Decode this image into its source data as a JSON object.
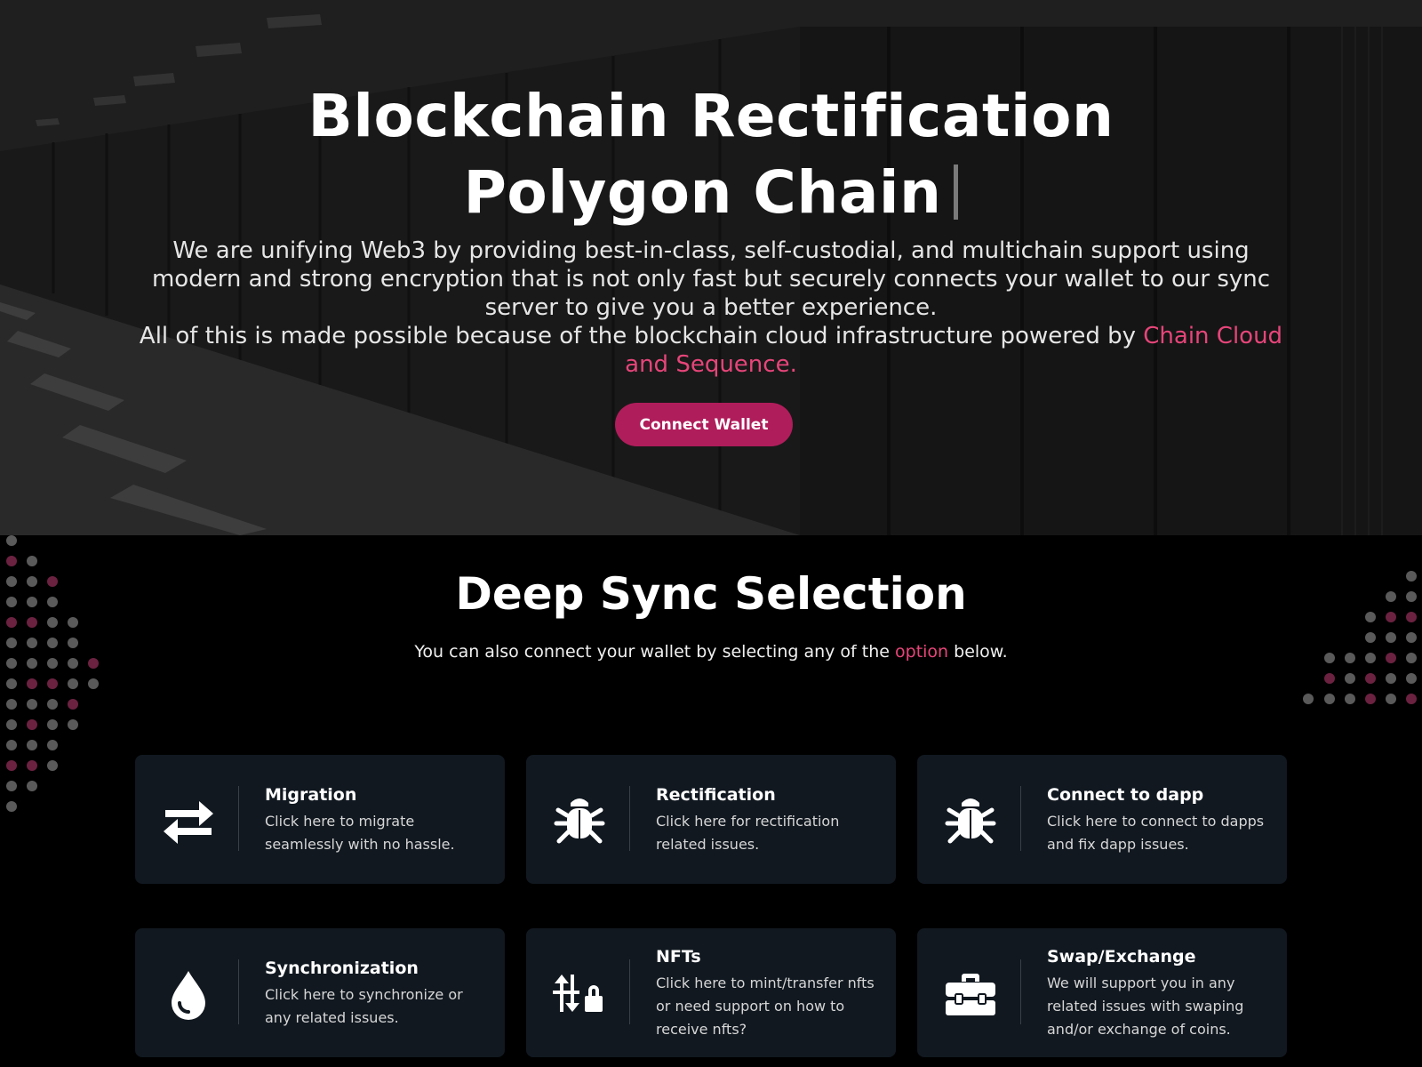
{
  "hero": {
    "title_line1": "Blockchain Rectification",
    "title_line2": "Polygon Chain",
    "paragraph1": "We are unifying Web3 by providing best-in-class, self-custodial, and multichain support using modern and strong encryption that is not only fast but securely connects your wallet to our sync server to give you a better experience.",
    "paragraph2_prefix": "All of this is made possible because of the blockchain cloud infrastructure powered by ",
    "paragraph2_highlight": "Chain Cloud and Sequence.",
    "button_label": "Connect Wallet",
    "button_color": "#b01d5b",
    "accent_color": "#e6457a"
  },
  "section": {
    "title": "Deep Sync Selection",
    "subtitle_prefix": "You can also connect your wallet by selecting any of the ",
    "subtitle_highlight": "option",
    "subtitle_suffix": " below."
  },
  "cards": [
    {
      "title": "Migration",
      "description": "Click here to migrate seamlessly with no hassle.",
      "icon": "arrows-exchange-icon"
    },
    {
      "title": "Rectification",
      "description": "Click here for rectification related issues.",
      "icon": "bug-icon"
    },
    {
      "title": "Connect to dapp",
      "description": "Click here to connect to dapps and fix dapp issues.",
      "icon": "bug-icon"
    },
    {
      "title": "Synchronization",
      "description": "Click here to synchronize or any related issues.",
      "icon": "droplet-icon"
    },
    {
      "title": "NFTs",
      "description": "Click here to mint/transfer nfts or need support on how to receive nfts?",
      "icon": "sort-lock-icon"
    },
    {
      "title": "Swap/Exchange",
      "description": "We will support you in any related issues with swaping and/or exchange of coins.",
      "icon": "toolbox-icon"
    }
  ]
}
